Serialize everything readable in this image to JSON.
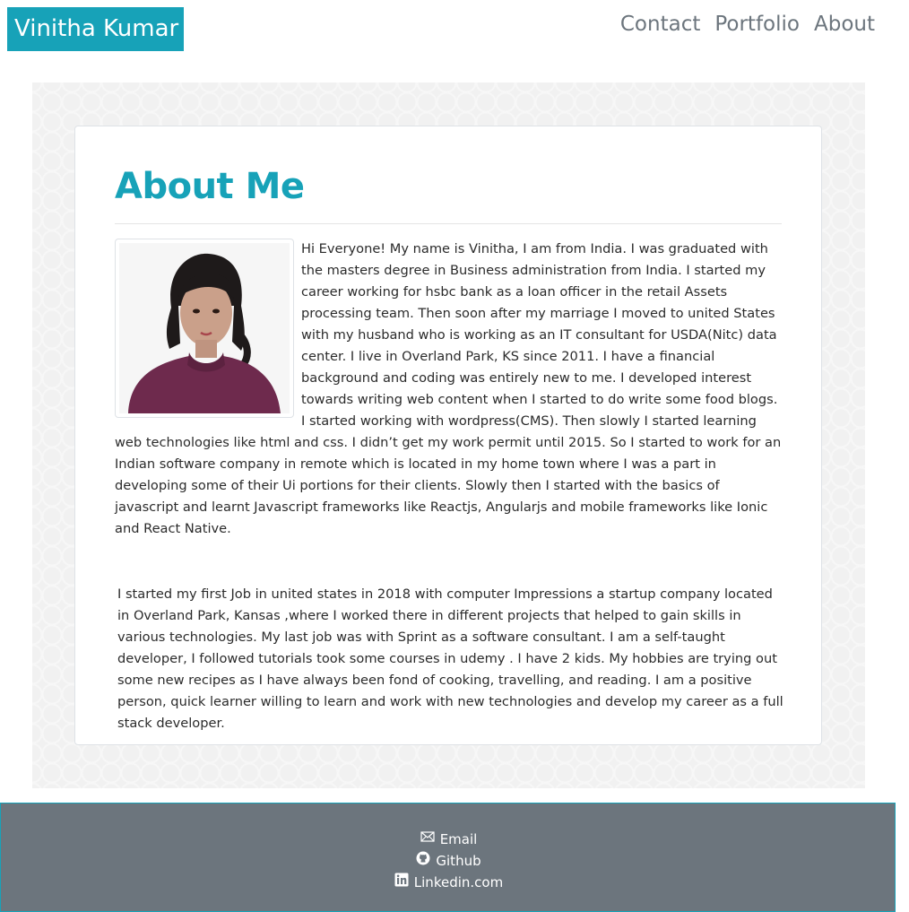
{
  "header": {
    "brand": "Vinitha Kumar",
    "nav": [
      "Contact",
      "Portfolio",
      "About"
    ]
  },
  "main": {
    "title": "About Me",
    "paragraph1": "Hi Everyone! My name is Vinitha, I am from India. I was graduated with the masters degree in Business administration from India. I started my career working for hsbc bank as a loan officer in the retail Assets processing team. Then soon after my marriage I moved to united States with my husband who is working as an IT consultant for USDA(Nitc) data center. I live in Overland Park, KS since 2011. I have a financial background and coding was entirely new to me. I developed interest towards writing web content when I started to do write some food blogs. I started working with wordpress(CMS). Then slowly I started learning web technologies like html and css. I didn’t get my work permit until 2015. So I started to work for an Indian software company in remote which is located in my home town where I was a part in developing some of their Ui portions for their clients. Slowly then I started with the basics of javascript and learnt Javascript frameworks like Reactjs, Angularjs and mobile frameworks like Ionic and React Native.",
    "paragraph2": "I started my first Job in united states in 2018 with computer Impressions a startup company located in Overland Park, Kansas ,where I worked there in different projects that helped to gain skills in various technologies. My last job was with Sprint as a software consultant. I am a self-taught developer, I followed tutorials took some courses in udemy . I have 2 kids. My hobbies are trying out some new recipes as I have always been fond of cooking, travelling, and reading. I am a positive person, quick learner willing to learn and work with new technologies and develop my career as a full stack developer."
  },
  "footer": {
    "links": [
      {
        "label": "Email",
        "icon": "envelope-icon"
      },
      {
        "label": "Github",
        "icon": "github-icon"
      },
      {
        "label": "Linkedin.com",
        "icon": "linkedin-icon"
      }
    ]
  },
  "colors": {
    "brand": "#17a2b8",
    "footer_bg": "#6c757d",
    "nav_text": "#6c757d"
  }
}
